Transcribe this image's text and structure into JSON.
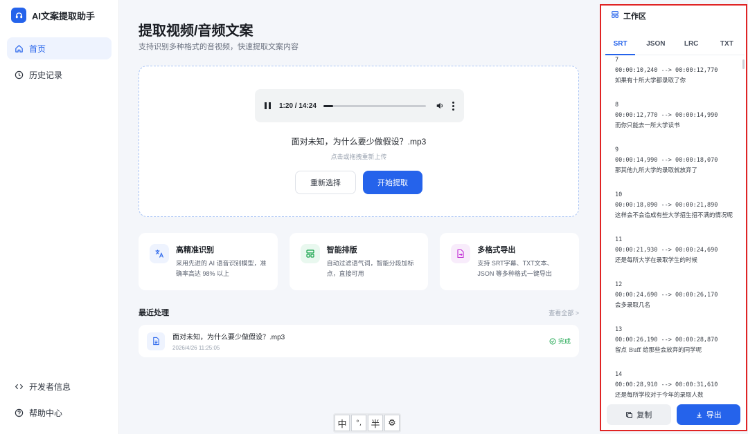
{
  "app": {
    "name": "AI文案提取助手"
  },
  "colors": {
    "primary": "#2563eb",
    "success": "#16a34a",
    "highlight_border": "#e02424"
  },
  "sidebar": {
    "items": [
      {
        "label": "首页",
        "icon": "home-icon",
        "active": true
      },
      {
        "label": "历史记录",
        "icon": "clock-icon",
        "active": false
      }
    ],
    "bottom_items": [
      {
        "label": "开发者信息",
        "icon": "code-icon"
      },
      {
        "label": "帮助中心",
        "icon": "help-circle-icon"
      }
    ]
  },
  "main": {
    "title": "提取视频/音频文案",
    "subtitle": "支持识别多种格式的音视频，快速提取文案内容",
    "player": {
      "time": "1:20 / 14:24",
      "progress": 0.093
    },
    "file_name": "面对未知，为什么要少做假设？.mp3",
    "reupload_hint": "点击或拖拽重新上传",
    "reselect_label": "重新选择",
    "start_label": "开始提取"
  },
  "features": [
    {
      "title": "高精准识别",
      "desc": "采用先进的 AI 语音识别模型，准确率高达 98% 以上",
      "icon": "translate-icon"
    },
    {
      "title": "智能排版",
      "desc": "自动过滤语气词，智能分段加标点，直接可用",
      "icon": "layout-icon"
    },
    {
      "title": "多格式导出",
      "desc": "支持 SRT字幕、TXT文本、JSON 等多种格式一键导出",
      "icon": "export-file-icon"
    }
  ],
  "recent": {
    "title": "最近处理",
    "view_all": "查看全部 >",
    "items": [
      {
        "name": "面对未知，为什么要少做假设？.mp3",
        "date": "2026/4/26 11:25:05",
        "status": "完成"
      }
    ]
  },
  "ime": {
    "keys": [
      "中",
      "°,",
      "半",
      "⚙"
    ]
  },
  "workspace": {
    "title": "工作区",
    "tabs": [
      "SRT",
      "JSON",
      "LRC",
      "TXT"
    ],
    "active_tab": "SRT",
    "cues": [
      {
        "index": "7",
        "time": "00:00:10,240 --> 00:00:12,770",
        "text": "如果有十所大学都录取了你"
      },
      {
        "index": "8",
        "time": "00:00:12,770 --> 00:00:14,990",
        "text": "而你只能去一所大学读书"
      },
      {
        "index": "9",
        "time": "00:00:14,990 --> 00:00:18,070",
        "text": "那其他九所大学的录取就放弃了"
      },
      {
        "index": "10",
        "time": "00:00:18,090 --> 00:00:21,890",
        "text": "这样会不会造成有些大学招生招不满的情况呢"
      },
      {
        "index": "11",
        "time": "00:00:21,930 --> 00:00:24,690",
        "text": "还是每所大学在录取学生的时候"
      },
      {
        "index": "12",
        "time": "00:00:24,690 --> 00:00:26,170",
        "text": "会多录取几名"
      },
      {
        "index": "13",
        "time": "00:00:26,190 --> 00:00:28,870",
        "text": "留点 Buff 给那些会放弃的同学呢"
      },
      {
        "index": "14",
        "time": "00:00:28,910 --> 00:00:31,610",
        "text": "还是每所学校对于今年的录取人数"
      }
    ],
    "copy_label": "复制",
    "export_label": "导出"
  }
}
